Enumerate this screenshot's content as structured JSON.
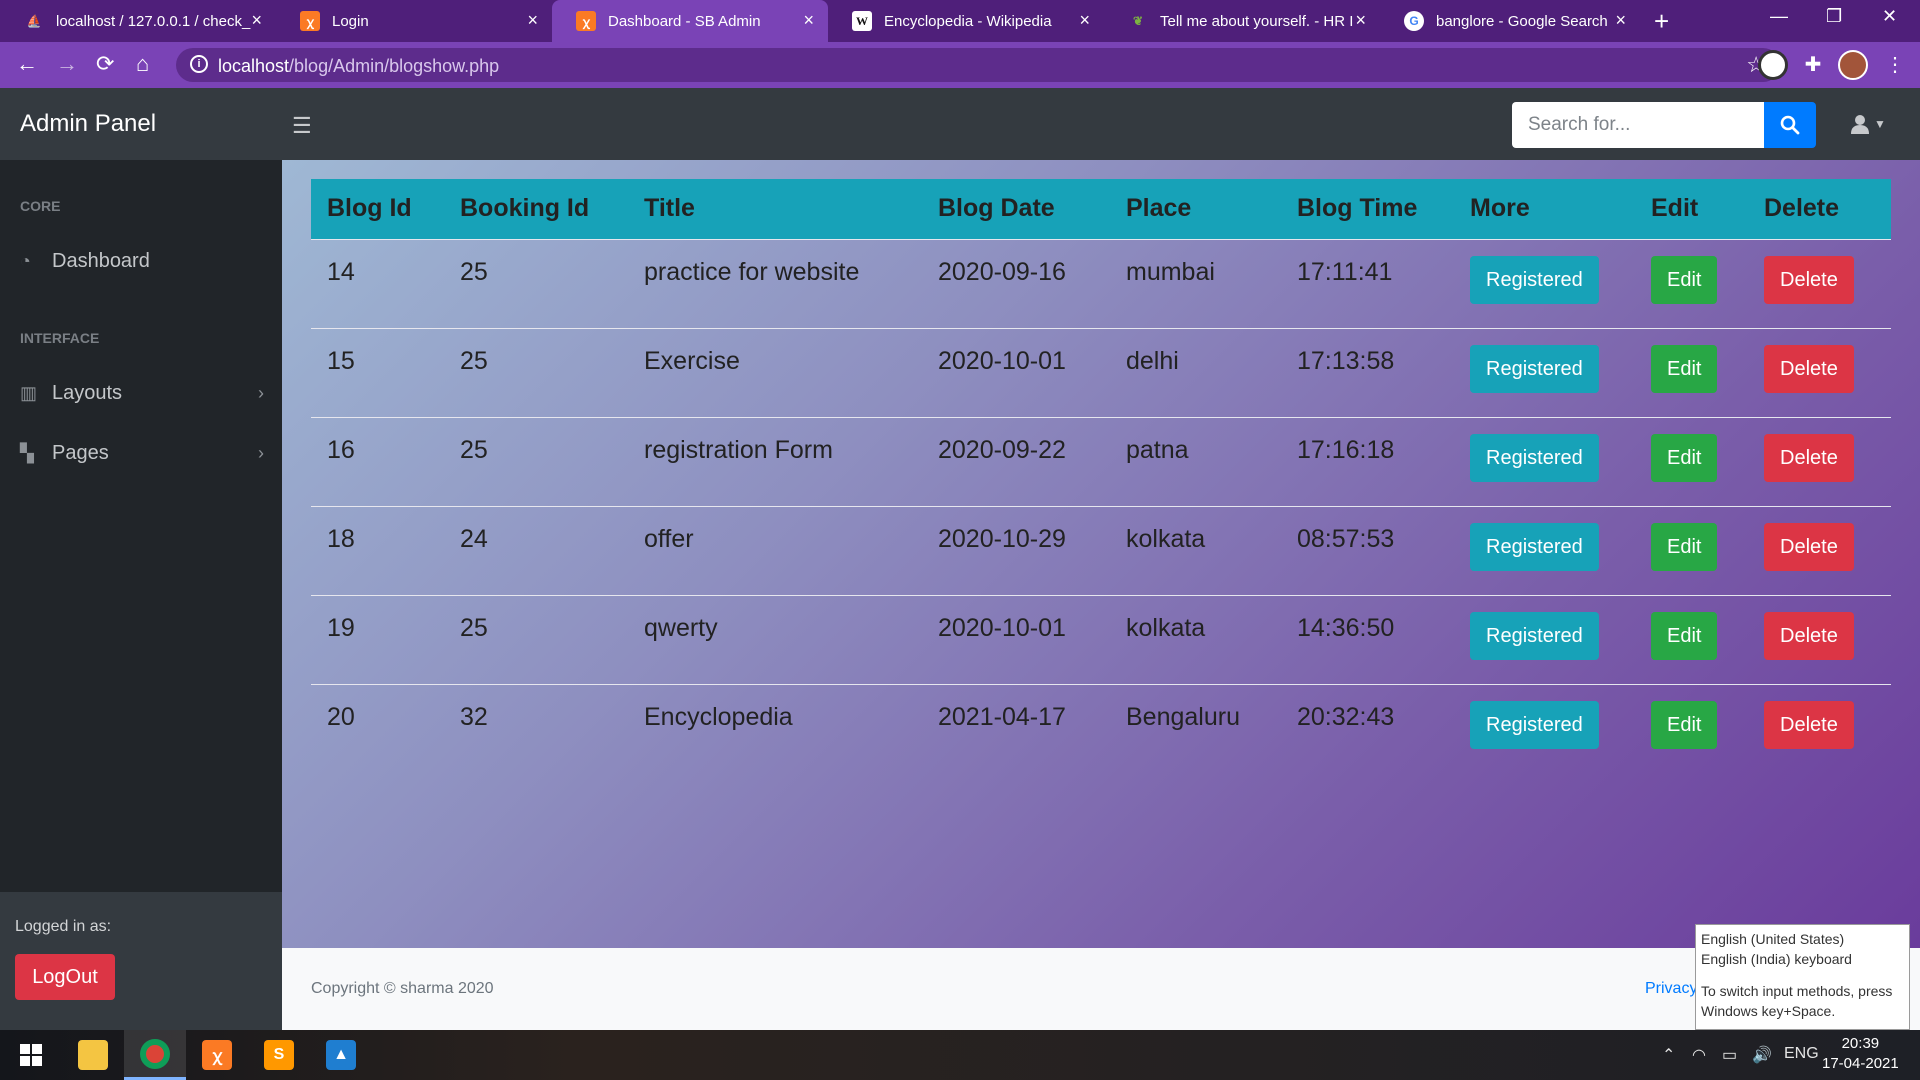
{
  "browser": {
    "tabs": [
      {
        "label": "localhost / 127.0.0.1 / check_",
        "icon": "phpmyadmin-icon",
        "active": false
      },
      {
        "label": "Login",
        "icon": "xampp-icon",
        "active": false
      },
      {
        "label": "Dashboard - SB Admin",
        "icon": "xampp-icon",
        "active": true
      },
      {
        "label": "Encyclopedia - Wikipedia",
        "icon": "wikipedia-icon",
        "active": false
      },
      {
        "label": "Tell me about yourself. - HR I",
        "icon": "leaf-icon",
        "active": false
      },
      {
        "label": "banglore - Google Search",
        "icon": "google-icon",
        "active": false
      }
    ],
    "url_host": "localhost",
    "url_path": "/blog/Admin/blogshow.php"
  },
  "app": {
    "brand": "Admin Panel",
    "search_placeholder": "Search for...",
    "sidebar": {
      "headings": [
        "CORE",
        "INTERFACE"
      ],
      "links": [
        {
          "label": "Dashboard",
          "icon": "tachometer-icon"
        },
        {
          "label": "Layouts",
          "icon": "columns-icon"
        },
        {
          "label": "Pages",
          "icon": "book-open-icon"
        }
      ],
      "logged_in_label": "Logged in as:",
      "logout_label": "LogOut"
    },
    "table": {
      "headers": [
        "Blog Id",
        "Booking Id",
        "Title",
        "Blog Date",
        "Place",
        "Blog Time",
        "More",
        "Edit",
        "Delete"
      ],
      "rows": [
        [
          "14",
          "25",
          "practice for website",
          "2020-09-16",
          "mumbai",
          "17:11:41"
        ],
        [
          "15",
          "25",
          "Exercise",
          "2020-10-01",
          "delhi",
          "17:13:58"
        ],
        [
          "16",
          "25",
          "registration Form",
          "2020-09-22",
          "patna",
          "17:16:18"
        ],
        [
          "18",
          "24",
          "offer",
          "2020-10-29",
          "kolkata",
          "08:57:53"
        ],
        [
          "19",
          "25",
          "qwerty",
          "2020-10-01",
          "kolkata",
          "14:36:50"
        ],
        [
          "20",
          "32",
          "Encyclopedia",
          "2021-04-17",
          "Bengaluru",
          "20:32:43"
        ]
      ],
      "more_label": "Registered",
      "edit_label": "Edit",
      "delete_label": "Delete"
    },
    "footer": {
      "copyright": "Copyright © sharma 2020",
      "privacy": "Privacy"
    }
  },
  "ime_tooltip": {
    "line1": "English (United States)",
    "line2": "English (India) keyboard",
    "line3": "To switch input methods, press Windows key+Space."
  },
  "taskbar": {
    "language": "ENG",
    "time": "20:39",
    "date": "17-04-2021"
  },
  "colors": {
    "primary": "#007bff",
    "info": "#17a2b8",
    "success": "#28a745",
    "danger": "#dc3545",
    "browser_frame": "#7a43b6"
  }
}
